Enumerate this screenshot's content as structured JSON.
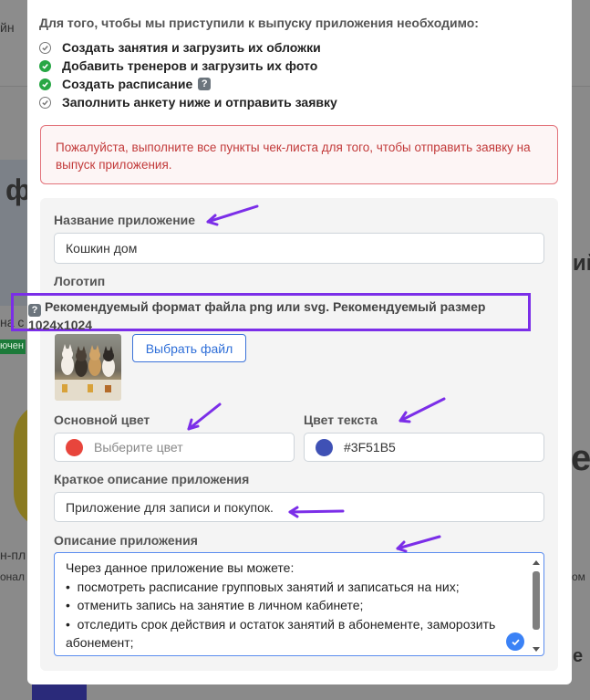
{
  "background": {
    "fragment_1": "йн",
    "fragment_2": "ф",
    "fragment_3": "ий",
    "fragment_4": "на с",
    "fragment_5": "ючен",
    "fragment_6": "е",
    "fragment_7": "н-пл",
    "fragment_8": "онал",
    "fragment_9": "ом",
    "fragment_10": "е"
  },
  "intro": "Для того, чтобы мы приступили к выпуску приложения необходимо:",
  "checklist": [
    {
      "label": "Создать занятия и загрузить их обложки",
      "status": "todo"
    },
    {
      "label": "Добавить тренеров и загрузить их фото",
      "status": "done"
    },
    {
      "label": "Создать расписание",
      "status": "done",
      "help": "?"
    },
    {
      "label": "Заполнить анкету ниже и отправить заявку",
      "status": "todo"
    }
  ],
  "alert": "Пожалуйста, выполните все пункты чек-листа для того, чтобы отправить заявку на выпуск приложения.",
  "form": {
    "app_name_label": "Название приложение",
    "app_name_value": "Кошкин дом",
    "logo_label": "Логотип",
    "logo_hint_icon": "?",
    "logo_hint": "Рекомендуемый формат файла png или svg. Рекомендуемый размер 1024x1024",
    "choose_file": "Выбрать файл",
    "main_color_label": "Основной цвет",
    "main_color_placeholder": "Выберите цвет",
    "main_color_swatch": "#E8453C",
    "text_color_label": "Цвет текста",
    "text_color_value": "#3F51B5",
    "short_desc_label": "Краткое описание приложения",
    "short_desc_value": "Приложение для записи и покупок.",
    "desc_label": "Описание приложения",
    "desc_lines": [
      "Через данное приложение вы можете:",
      "•  посмотреть расписание групповых занятий и записаться на них;",
      "•  отменить запись на занятие в личном кабинете;",
      "•  отследить срок действия и остаток занятий в абонементе, заморозить абонемент;"
    ]
  },
  "colors": {
    "annotation": "#7b2ee8",
    "success": "#28a745",
    "alert_text": "#c23a3a",
    "accent": "#3b72d9"
  }
}
